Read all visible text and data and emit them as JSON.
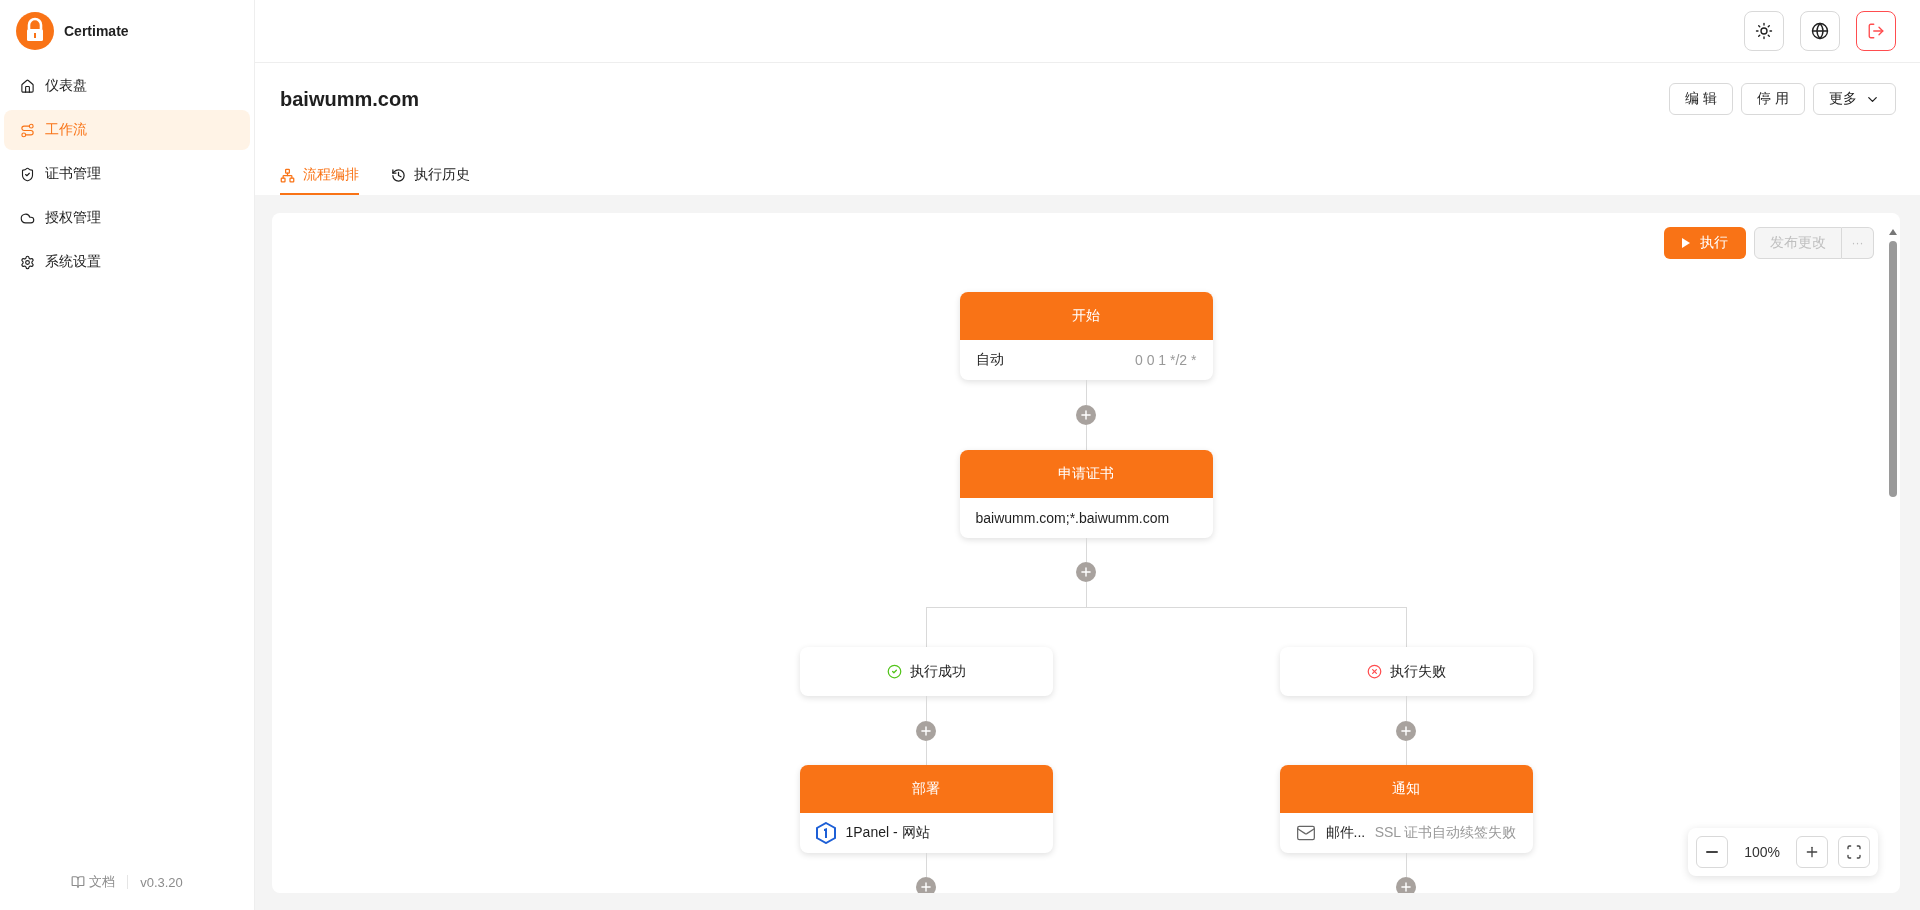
{
  "app": {
    "name": "Certimate"
  },
  "sidebar": {
    "items": [
      {
        "label": "仪表盘",
        "selected": false
      },
      {
        "label": "工作流",
        "selected": true
      },
      {
        "label": "证书管理",
        "selected": false
      },
      {
        "label": "授权管理",
        "selected": false
      },
      {
        "label": "系统设置",
        "selected": false
      }
    ],
    "footer": {
      "docs": "文档",
      "version": "v0.3.20"
    }
  },
  "workflow": {
    "title": "baiwumm.com",
    "actions": [
      "编 辑",
      "停 用",
      "更多"
    ]
  },
  "tabs": [
    {
      "label": "流程编排",
      "selected": true
    },
    {
      "label": "执行历史",
      "selected": false
    }
  ],
  "toolbar": {
    "run": "执行",
    "publish": {
      "label": "发布更改",
      "disabled": true
    },
    "more": "···"
  },
  "flow": {
    "start": {
      "title": "开始",
      "mode": "自动",
      "cron": "0 0 1 */2 *"
    },
    "apply": {
      "title": "申请证书",
      "domains": "baiwumm.com;*.baiwumm.com"
    },
    "branches": [
      {
        "kind": "success",
        "label": "执行成功",
        "action": {
          "kind": "deploy",
          "title": "部署",
          "provider": "1Panel - 网站"
        }
      },
      {
        "kind": "failure",
        "label": "执行失败",
        "action": {
          "kind": "notify",
          "title": "通知",
          "channel": "邮件...",
          "message": "SSL 证书自动续签失败"
        }
      }
    ]
  },
  "zoom": {
    "value": "100%"
  }
}
